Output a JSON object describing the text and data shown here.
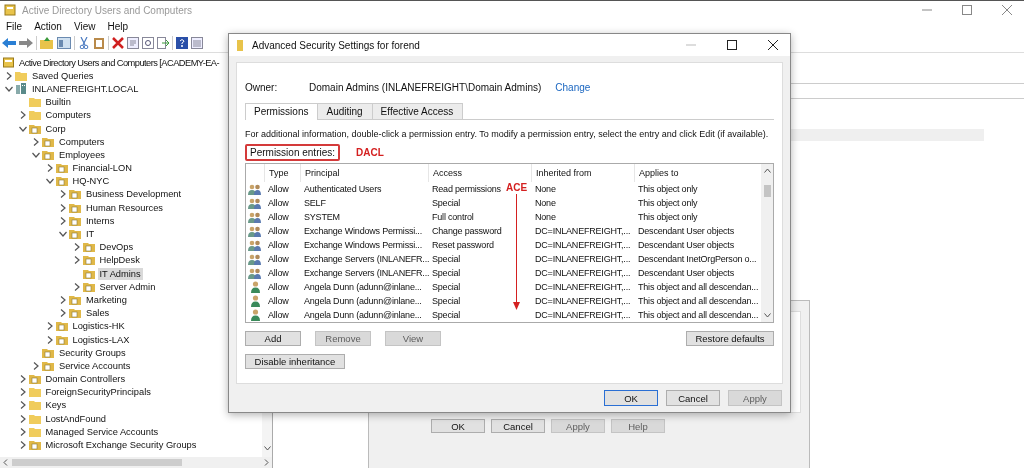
{
  "main_window": {
    "title": "Active Directory Users and Computers",
    "menu": [
      "File",
      "Action",
      "View",
      "Help"
    ]
  },
  "tree": {
    "root": "Active Directory Users and Computers [ACADEMY-EA-",
    "items": [
      {
        "label": "Saved Queries",
        "kind": "folder",
        "expandable": true,
        "expanded": false,
        "selected": false
      },
      {
        "label": "INLANEFREIGHT.LOCAL",
        "kind": "domain",
        "expandable": true,
        "expanded": true,
        "selected": false,
        "children": [
          {
            "label": "Builtin",
            "kind": "folder",
            "expandable": false,
            "selected": false
          },
          {
            "label": "Computers",
            "kind": "folder",
            "expandable": true,
            "expanded": false,
            "selected": false
          },
          {
            "label": "Corp",
            "kind": "ou",
            "expandable": true,
            "expanded": true,
            "selected": false,
            "children": [
              {
                "label": "Computers",
                "kind": "ou",
                "expandable": true,
                "expanded": false,
                "selected": false
              },
              {
                "label": "Employees",
                "kind": "ou",
                "expandable": true,
                "expanded": true,
                "selected": false,
                "children": [
                  {
                    "label": "Financial-LON",
                    "kind": "ou",
                    "expandable": true,
                    "expanded": false,
                    "selected": false
                  },
                  {
                    "label": "HQ-NYC",
                    "kind": "ou",
                    "expandable": true,
                    "expanded": true,
                    "selected": false,
                    "children": [
                      {
                        "label": "Business Development",
                        "kind": "ou",
                        "expandable": true,
                        "expanded": false,
                        "selected": false
                      },
                      {
                        "label": "Human Resources",
                        "kind": "ou",
                        "expandable": true,
                        "expanded": false,
                        "selected": false
                      },
                      {
                        "label": "Interns",
                        "kind": "ou",
                        "expandable": true,
                        "expanded": false,
                        "selected": false
                      },
                      {
                        "label": "IT",
                        "kind": "ou",
                        "expandable": true,
                        "expanded": true,
                        "selected": false,
                        "children": [
                          {
                            "label": "DevOps",
                            "kind": "ou",
                            "expandable": true,
                            "expanded": false,
                            "selected": false
                          },
                          {
                            "label": "HelpDesk",
                            "kind": "ou",
                            "expandable": true,
                            "expanded": false,
                            "selected": false
                          },
                          {
                            "label": "IT Admins",
                            "kind": "ou",
                            "expandable": false,
                            "selected": true
                          },
                          {
                            "label": "Server Admin",
                            "kind": "ou",
                            "expandable": true,
                            "expanded": false,
                            "selected": false
                          }
                        ]
                      },
                      {
                        "label": "Marketing",
                        "kind": "ou",
                        "expandable": true,
                        "expanded": false,
                        "selected": false
                      },
                      {
                        "label": "Sales",
                        "kind": "ou",
                        "expandable": true,
                        "expanded": false,
                        "selected": false
                      }
                    ]
                  },
                  {
                    "label": "Logistics-HK",
                    "kind": "ou",
                    "expandable": true,
                    "expanded": false,
                    "selected": false
                  },
                  {
                    "label": "Logistics-LAX",
                    "kind": "ou",
                    "expandable": true,
                    "expanded": false,
                    "selected": false
                  }
                ]
              },
              {
                "label": "Security Groups",
                "kind": "ou",
                "expandable": false,
                "selected": false
              },
              {
                "label": "Service Accounts",
                "kind": "ou",
                "expandable": true,
                "expanded": false,
                "selected": false
              }
            ]
          },
          {
            "label": "Domain Controllers",
            "kind": "ou",
            "expandable": true,
            "expanded": false,
            "selected": false
          },
          {
            "label": "ForeignSecurityPrincipals",
            "kind": "folder",
            "expandable": true,
            "expanded": false,
            "selected": false
          },
          {
            "label": "Keys",
            "kind": "folder",
            "expandable": true,
            "expanded": false,
            "selected": false
          },
          {
            "label": "LostAndFound",
            "kind": "folder",
            "expandable": true,
            "expanded": false,
            "selected": false
          },
          {
            "label": "Managed Service Accounts",
            "kind": "folder",
            "expandable": true,
            "expanded": false,
            "selected": false
          },
          {
            "label": "Microsoft Exchange Security Groups",
            "kind": "ou",
            "expandable": true,
            "expanded": false,
            "selected": false
          }
        ]
      }
    ]
  },
  "dialog": {
    "title": "Advanced Security Settings for forend",
    "owner_label": "Owner:",
    "owner": "Domain Admins (INLANEFREIGHT\\Domain Admins)",
    "change_link": "Change",
    "tabs": [
      {
        "label": "Permissions",
        "selected": true
      },
      {
        "label": "Auditing",
        "selected": false
      },
      {
        "label": "Effective Access",
        "selected": false
      }
    ],
    "info": "For additional information, double-click a permission entry. To modify a permission entry, select the entry and click Edit (if available).",
    "entries_label": "Permission entries:",
    "columns": [
      "Type",
      "Principal",
      "Access",
      "Inherited from",
      "Applies to"
    ],
    "rows": [
      {
        "kind": "group",
        "type": "Allow",
        "principal": "Authenticated Users",
        "access": "Read permissions",
        "inherited_from": "None",
        "applies_to": "This object only"
      },
      {
        "kind": "group",
        "type": "Allow",
        "principal": "SELF",
        "access": "Special",
        "inherited_from": "None",
        "applies_to": "This object only"
      },
      {
        "kind": "group",
        "type": "Allow",
        "principal": "SYSTEM",
        "access": "Full control",
        "inherited_from": "None",
        "applies_to": "This object only"
      },
      {
        "kind": "group",
        "type": "Allow",
        "principal": "Exchange Windows Permissi...",
        "access": "Change password",
        "inherited_from": "DC=INLANEFREIGHT,...",
        "applies_to": "Descendant User objects"
      },
      {
        "kind": "group",
        "type": "Allow",
        "principal": "Exchange Windows Permissi...",
        "access": "Reset password",
        "inherited_from": "DC=INLANEFREIGHT,...",
        "applies_to": "Descendant User objects"
      },
      {
        "kind": "group",
        "type": "Allow",
        "principal": "Exchange Servers (INLANEFR...",
        "access": "Special",
        "inherited_from": "DC=INLANEFREIGHT,...",
        "applies_to": "Descendant InetOrgPerson o..."
      },
      {
        "kind": "group",
        "type": "Allow",
        "principal": "Exchange Servers (INLANEFR...",
        "access": "Special",
        "inherited_from": "DC=INLANEFREIGHT,...",
        "applies_to": "Descendant User objects"
      },
      {
        "kind": "user",
        "type": "Allow",
        "principal": "Angela Dunn (adunn@inlane...",
        "access": "Special",
        "inherited_from": "DC=INLANEFREIGHT,...",
        "applies_to": "This object and all descendan..."
      },
      {
        "kind": "user",
        "type": "Allow",
        "principal": "Angela Dunn (adunn@inlane...",
        "access": "Special",
        "inherited_from": "DC=INLANEFREIGHT,...",
        "applies_to": "This object and all descendan..."
      },
      {
        "kind": "user",
        "type": "Allow",
        "principal": "Angela Dunn (adunn@inlane...",
        "access": "Special",
        "inherited_from": "DC=INLANEFREIGHT,...",
        "applies_to": "This object and all descendan..."
      }
    ],
    "list_buttons": [
      {
        "label": "Add",
        "disabled": false
      },
      {
        "label": "Remove",
        "disabled": true
      },
      {
        "label": "View",
        "disabled": true
      }
    ],
    "restore_button": "Restore defaults",
    "inheritance_button": "Disable inheritance",
    "buttons": [
      {
        "label": "OK",
        "disabled": false
      },
      {
        "label": "Cancel",
        "disabled": false
      },
      {
        "label": "Apply",
        "disabled": true
      }
    ]
  },
  "annotations": {
    "dacl": "DACL",
    "ace": "ACE"
  },
  "rear_dialog": {
    "buttons": [
      {
        "label": "OK",
        "disabled": false
      },
      {
        "label": "Cancel",
        "disabled": false
      },
      {
        "label": "Apply",
        "disabled": true
      },
      {
        "label": "Help",
        "disabled": true
      }
    ]
  }
}
